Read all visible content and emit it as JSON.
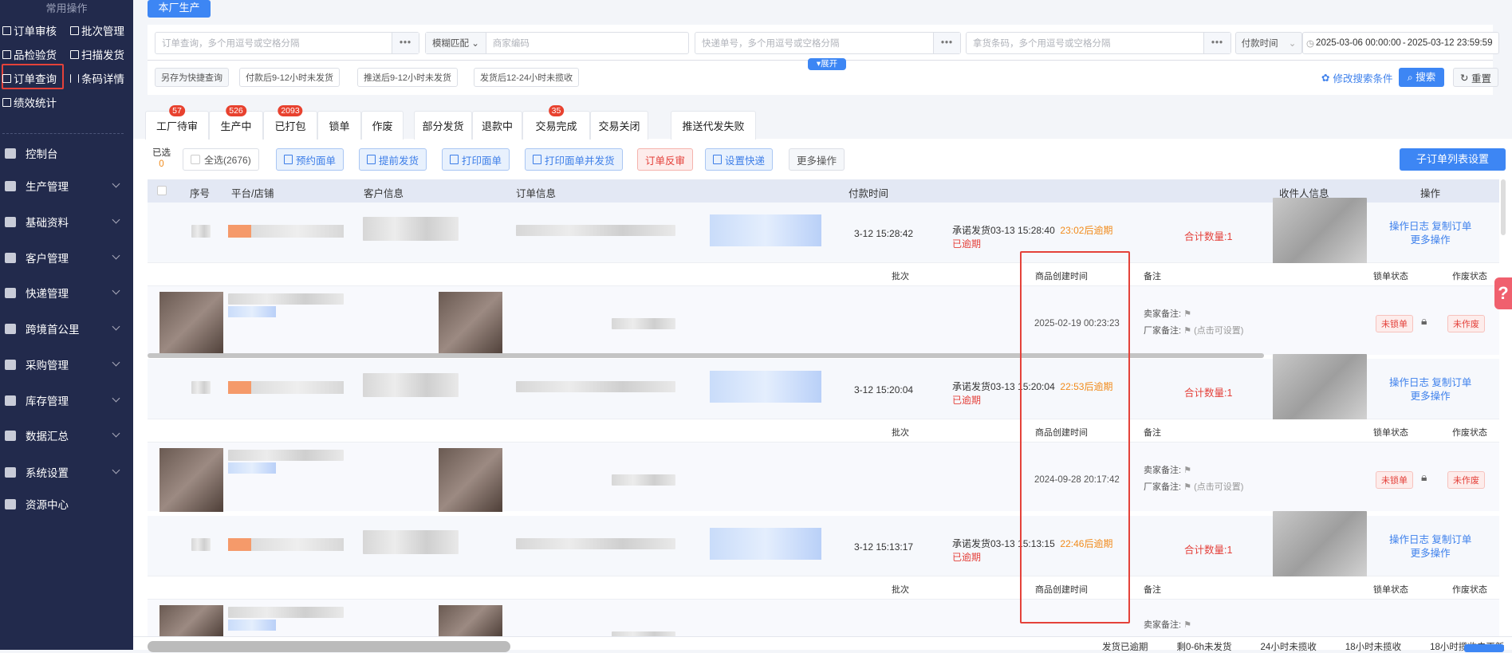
{
  "sidebar": {
    "quick_title": "常用操作",
    "quick_items": [
      {
        "label": "订单审核",
        "icon": "check-square-icon"
      },
      {
        "label": "批次管理",
        "icon": "batch-icon"
      },
      {
        "label": "品检验货",
        "icon": "inspect-icon"
      },
      {
        "label": "扫描发货",
        "icon": "scan-icon"
      },
      {
        "label": "订单查询",
        "icon": "search-doc-icon",
        "highlighted": true
      },
      {
        "label": "条码详情",
        "icon": "barcode-icon"
      },
      {
        "label": "绩效统计",
        "icon": "chart-icon"
      }
    ],
    "nav": [
      {
        "label": "控制台",
        "expandable": false
      },
      {
        "label": "生产管理",
        "expandable": true
      },
      {
        "label": "基础资料",
        "expandable": true
      },
      {
        "label": "客户管理",
        "expandable": true
      },
      {
        "label": "快递管理",
        "expandable": true
      },
      {
        "label": "跨境首公里",
        "expandable": true
      },
      {
        "label": "采购管理",
        "expandable": true
      },
      {
        "label": "库存管理",
        "expandable": true
      },
      {
        "label": "数据汇总",
        "expandable": true
      },
      {
        "label": "系统设置",
        "expandable": true
      },
      {
        "label": "资源中心",
        "expandable": false
      }
    ]
  },
  "top_tab": "本厂生产",
  "filters": {
    "order_ph": "订单查询，多个用逗号或空格分隔",
    "match_mode": "模糊匹配",
    "merchant_ph": "商家编码",
    "express_ph": "快递单号，多个用逗号或空格分隔",
    "pick_ph": "拿货条码，多个用逗号或空格分隔",
    "time_type": "付款时间",
    "date_start": "2025-03-06 00:00:00",
    "date_sep": "-",
    "date_end": "2025-03-12 23:59:59",
    "expand": "▾展开",
    "quick": [
      "另存为快捷查询",
      "付款后9-12小时未发货",
      "推送后9-12小时未发货",
      "发货后12-24小时未揽收"
    ],
    "modify": "修改搜索条件",
    "search": "搜索",
    "reset": "重置"
  },
  "tabs": [
    {
      "label": "工厂待审",
      "badge": "57"
    },
    {
      "label": "生产中",
      "badge": "526"
    },
    {
      "label": "已打包",
      "badge": "2093"
    },
    {
      "label": "锁单",
      "badge": ""
    },
    {
      "label": "作废",
      "badge": ""
    },
    {
      "label": "部分发货",
      "badge": ""
    },
    {
      "label": "退款中",
      "badge": ""
    },
    {
      "label": "交易完成",
      "badge": "35"
    },
    {
      "label": "交易关闭",
      "badge": ""
    },
    {
      "label": "推送代发失败",
      "badge": ""
    }
  ],
  "toolbar": {
    "selected_label": "已选",
    "selected_count": "0",
    "select_all": "全选(2676)",
    "buttons": [
      "预约面单",
      "提前发货",
      "打印面单",
      "打印面单并发货",
      "订单反审",
      "设置快递",
      "更多操作"
    ],
    "settings": "子订单列表设置"
  },
  "table": {
    "headers": {
      "index": "序号",
      "platform": "平台/店铺",
      "customer": "客户信息",
      "order": "订单信息",
      "pay_time": "付款时间",
      "receiver": "收件人信息",
      "actions": "操作"
    },
    "sub_headers": {
      "batch": "批次",
      "created": "商品创建时间",
      "remark": "备注",
      "lock": "锁单状态",
      "void": "作废状态"
    },
    "orders": [
      {
        "pay_time": "3-12 15:28:42",
        "promise": "承诺发货03-13 15:28:40",
        "countdown": "23:02后逾期",
        "overdue": "已逾期",
        "total": "合计数量:1",
        "act_log": "操作日志",
        "act_copy": "复制订单",
        "act_more": "更多操作",
        "created": "2025-02-19 00:23:23",
        "seller_note": "卖家备注:",
        "factory_note": "厂家备注:",
        "note_hint": "(点击可设置)",
        "lock": "未锁单",
        "void": "未作废"
      },
      {
        "pay_time": "3-12 15:20:04",
        "promise": "承诺发货03-13 15:20:04",
        "countdown": "22:53后逾期",
        "overdue": "已逾期",
        "total": "合计数量:1",
        "act_log": "操作日志",
        "act_copy": "复制订单",
        "act_more": "更多操作",
        "created": "2024-09-28 20:17:42",
        "seller_note": "卖家备注:",
        "factory_note": "厂家备注:",
        "note_hint": "(点击可设置)",
        "lock": "未锁单",
        "void": "未作废"
      },
      {
        "pay_time": "3-12 15:13:17",
        "promise": "承诺发货03-13 15:13:15",
        "countdown": "22:46后逾期",
        "overdue": "已逾期",
        "total": "合计数量:1",
        "act_log": "操作日志",
        "act_copy": "复制订单",
        "act_more": "更多操作",
        "created": "",
        "seller_note": "卖家备注:",
        "factory_note": "",
        "note_hint": "",
        "lock": "",
        "void": ""
      }
    ]
  },
  "footer": {
    "stats": [
      "发货已逾期",
      "剩0-6h未发货",
      "24小时未揽收",
      "18小时未揽收",
      "18小时揽收未更新"
    ]
  },
  "help": "?",
  "colors": {
    "sidebar": "#222a4c",
    "primary": "#3d86f4",
    "danger": "#e4403a",
    "warning": "#f18b1c",
    "highlight_box": "#e4423a"
  }
}
